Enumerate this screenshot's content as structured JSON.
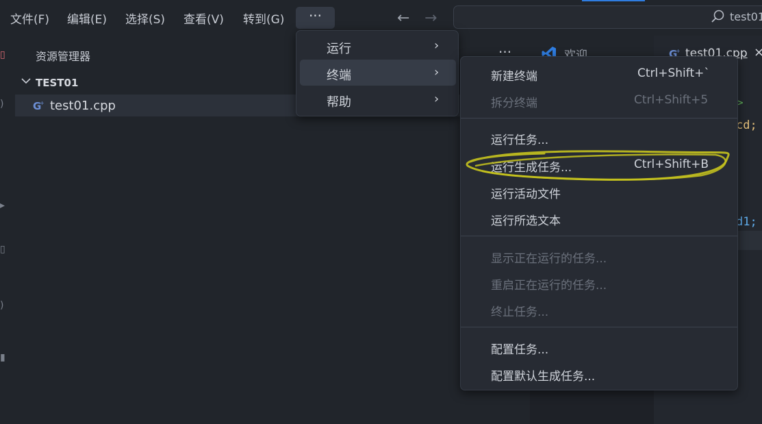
{
  "menubar": {
    "items": [
      "文件(F)",
      "编辑(E)",
      "选择(S)",
      "查看(V)",
      "转到(G)"
    ],
    "more": "···"
  },
  "search": {
    "text": "test01"
  },
  "explorer": {
    "title": "资源管理器",
    "folder": "TEST01",
    "file": "test01.cpp"
  },
  "editor": {
    "more": "···",
    "tab_welcome": "欢迎",
    "tab_file": "test01.cpp",
    "tab_close": "×",
    "code_line_1": ">",
    "code_line_2": "cd;",
    "code_line_3": "d1;"
  },
  "menu_level1": {
    "items": [
      {
        "label": "运行"
      },
      {
        "label": "终端"
      },
      {
        "label": "帮助"
      }
    ]
  },
  "menu_terminal": {
    "new_terminal": {
      "label": "新建终端",
      "shortcut": "Ctrl+Shift+`"
    },
    "split_terminal": {
      "label": "拆分终端",
      "shortcut": "Ctrl+Shift+5"
    },
    "run_task": {
      "label": "运行任务..."
    },
    "run_build_task": {
      "label": "运行生成任务...",
      "shortcut": "Ctrl+Shift+B"
    },
    "run_active_file": {
      "label": "运行活动文件"
    },
    "run_selected_text": {
      "label": "运行所选文本"
    },
    "show_running_tasks": {
      "label": "显示正在运行的任务..."
    },
    "restart_running_task": {
      "label": "重启正在运行的任务..."
    },
    "terminate_task": {
      "label": "终止任务..."
    },
    "configure_tasks": {
      "label": "配置任务..."
    },
    "configure_default_build_task": {
      "label": "配置默认生成任务..."
    }
  },
  "colors": {
    "accent": "#2f7de1",
    "scribble": "#c8c41e",
    "menu_bg": "#272b33"
  }
}
